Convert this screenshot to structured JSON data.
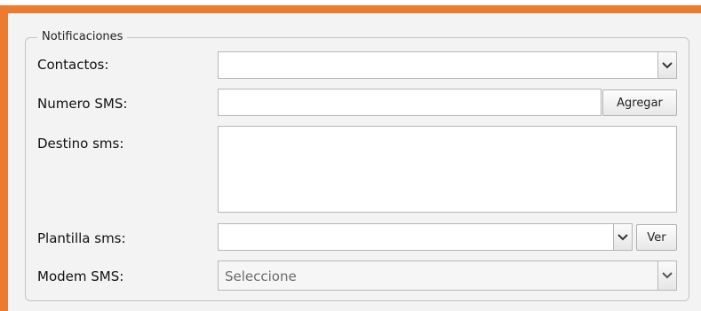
{
  "fieldset": {
    "legend": "Notificaciones"
  },
  "contactos": {
    "label": "Contactos:",
    "value": ""
  },
  "numero_sms": {
    "label": "Numero SMS:",
    "value": "",
    "add_button": "Agregar"
  },
  "destino_sms": {
    "label": "Destino sms:",
    "value": ""
  },
  "plantilla_sms": {
    "label": "Plantilla sms:",
    "value": "",
    "view_button": "Ver"
  },
  "modem_sms": {
    "label": "Modem SMS:",
    "selected": "Seleccione"
  },
  "colors": {
    "accent": "#ec7a2f",
    "panel_bg": "#f3f3f3",
    "border": "#b7b7b7"
  },
  "icons": {
    "combo": "chevron-down-icon"
  }
}
